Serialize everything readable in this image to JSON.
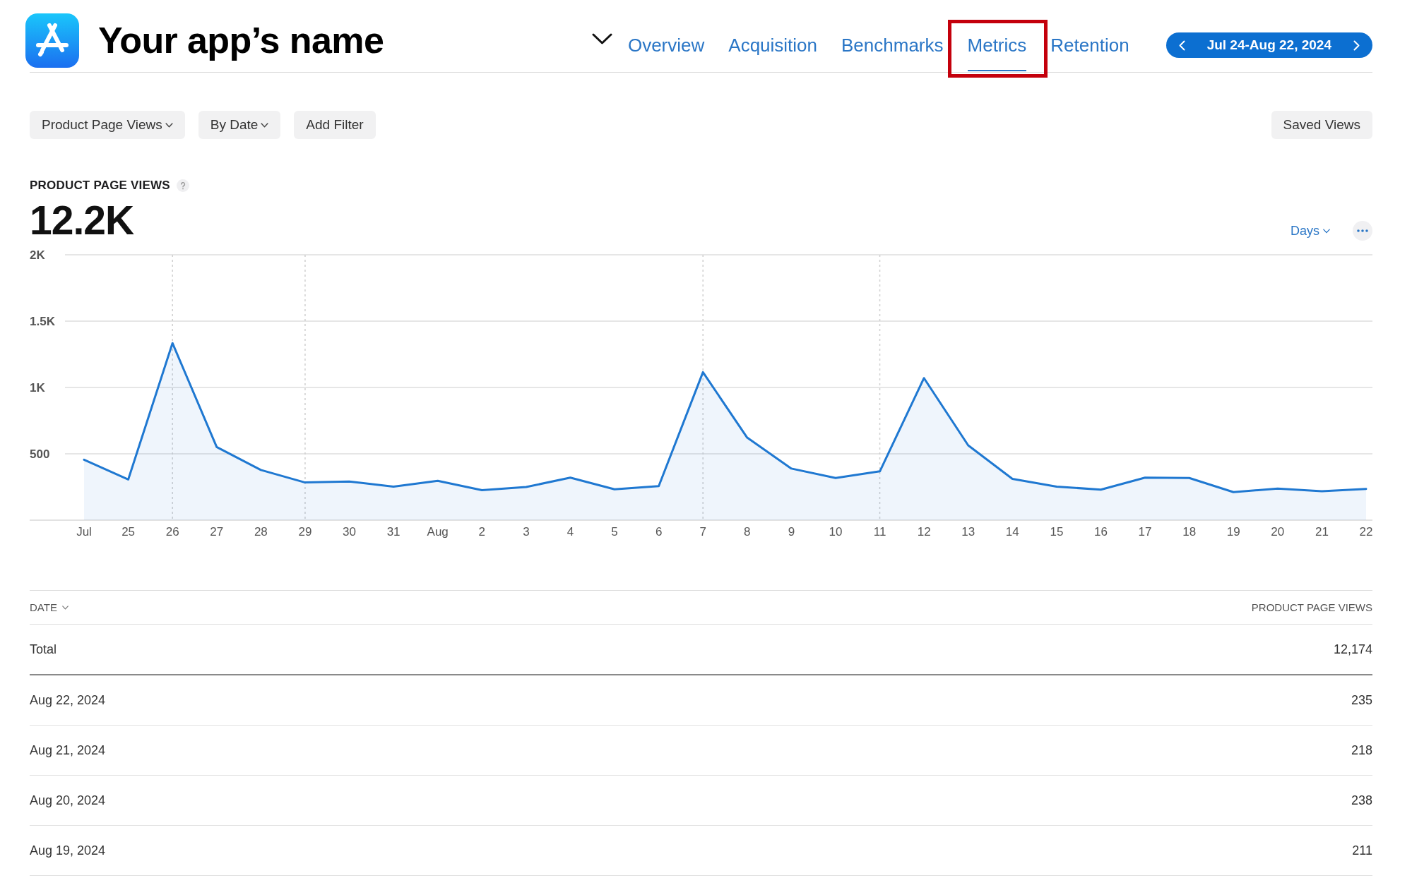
{
  "app": {
    "name": "Your app’s name"
  },
  "tabs": [
    {
      "label": "Overview",
      "selected": false,
      "highlighted": false
    },
    {
      "label": "Acquisition",
      "selected": false,
      "highlighted": false
    },
    {
      "label": "Benchmarks",
      "selected": false,
      "highlighted": false
    },
    {
      "label": "Metrics",
      "selected": true,
      "highlighted": true
    },
    {
      "label": "Retention",
      "selected": false,
      "highlighted": false
    }
  ],
  "date_range": {
    "label": "Jul 24-Aug 22, 2024"
  },
  "filters": [
    {
      "label": "Product Page Views",
      "kind": "dropdown"
    },
    {
      "label": "By Date",
      "kind": "dropdown"
    },
    {
      "label": "Add Filter",
      "kind": "button"
    }
  ],
  "saved_views": {
    "label": "Saved Views"
  },
  "metric": {
    "title": "PRODUCT PAGE VIEWS",
    "value": "12.2K",
    "interval": "Days",
    "chart_data": {
      "type": "area",
      "categories": [
        "Jul",
        "25",
        "26",
        "27",
        "28",
        "29",
        "30",
        "31",
        "Aug",
        "2",
        "3",
        "4",
        "5",
        "6",
        "7",
        "8",
        "9",
        "10",
        "11",
        "12",
        "13",
        "14",
        "15",
        "16",
        "17",
        "18",
        "19",
        "20",
        "21",
        "22"
      ],
      "series": [
        {
          "color": "#1f78d1",
          "values": [
            456,
            307,
            1334,
            551,
            378,
            284,
            291,
            253,
            297,
            226,
            250,
            321,
            233,
            257,
            1115,
            622,
            389,
            318,
            368,
            1071,
            564,
            311,
            253,
            230,
            321,
            318,
            211,
            238,
            218,
            235
          ]
        }
      ],
      "ylim": [
        0,
        2000
      ],
      "yticks": [
        {
          "value": 500,
          "label": "500"
        },
        {
          "value": 1000,
          "label": "1K"
        },
        {
          "value": 1500,
          "label": "1.5K"
        },
        {
          "value": 2000,
          "label": "2K"
        }
      ],
      "grid": true,
      "ref_lines": [
        {
          "axis": "x",
          "value": "26"
        },
        {
          "axis": "x",
          "value": "29"
        },
        {
          "axis": "x",
          "value": "7"
        },
        {
          "axis": "x",
          "value": "11"
        }
      ]
    }
  },
  "table": {
    "columns": [
      {
        "label": "DATE",
        "sorted": true
      },
      {
        "label": "PRODUCT PAGE VIEWS",
        "sorted": false
      }
    ],
    "rows": [
      {
        "kind": "total",
        "cells": [
          "Total",
          "12,174"
        ]
      },
      {
        "kind": "day",
        "cells": [
          "Aug 22, 2024",
          "235"
        ]
      },
      {
        "kind": "day",
        "cells": [
          "Aug 21, 2024",
          "218"
        ]
      },
      {
        "kind": "day",
        "cells": [
          "Aug 20, 2024",
          "238"
        ]
      },
      {
        "kind": "day",
        "cells": [
          "Aug 19, 2024",
          "211"
        ]
      }
    ]
  }
}
